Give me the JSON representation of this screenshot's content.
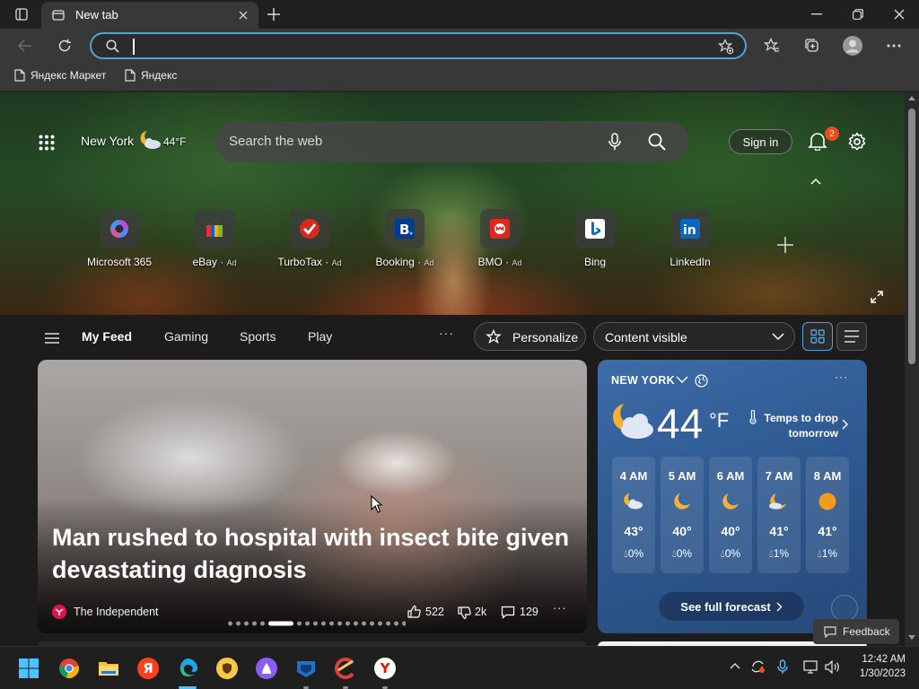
{
  "browser": {
    "tab_title": "New tab",
    "address_value": "",
    "bookmarks": [
      {
        "label": "Яндекс Маркет"
      },
      {
        "label": "Яндекс"
      }
    ]
  },
  "newtab": {
    "location": "New York",
    "temp": "44°F",
    "search_placeholder": "Search the web",
    "sign_in": "Sign in",
    "notifications_count": "2",
    "quick_links": [
      {
        "label": "Microsoft 365",
        "ad": ""
      },
      {
        "label": "eBay",
        "ad": "Ad"
      },
      {
        "label": "TurboTax",
        "ad": "Ad"
      },
      {
        "label": "Booking",
        "ad": "Ad"
      },
      {
        "label": "BMO",
        "ad": "Ad"
      },
      {
        "label": "Bing",
        "ad": ""
      },
      {
        "label": "LinkedIn",
        "ad": ""
      }
    ]
  },
  "feed": {
    "tabs": [
      "My Feed",
      "Gaming",
      "Sports",
      "Play"
    ],
    "more": "···",
    "personalize": "Personalize",
    "content_select": "Content visible",
    "feedback": "Feedback"
  },
  "hero": {
    "headline": "Man rushed to hospital with insect bite given devastating diagnosis",
    "source": "The Independent",
    "likes": "522",
    "dislikes": "2k",
    "comments": "129",
    "active_dot": 5,
    "total_dots": 20
  },
  "weather": {
    "city": "NEW YORK",
    "temp": "44",
    "unit": "°F",
    "alert": "Temps to drop tomorrow",
    "hours": [
      {
        "time": "4 AM",
        "temp": "43°",
        "precip": "0%",
        "icon": "moon-cloud-icon"
      },
      {
        "time": "5 AM",
        "temp": "40°",
        "precip": "0%",
        "icon": "moon-icon"
      },
      {
        "time": "6 AM",
        "temp": "40°",
        "precip": "0%",
        "icon": "moon-icon"
      },
      {
        "time": "7 AM",
        "temp": "41°",
        "precip": "1%",
        "icon": "moon-cloud-icon"
      },
      {
        "time": "8 AM",
        "temp": "41°",
        "precip": "1%",
        "icon": "sun-icon"
      }
    ],
    "forecast_button": "See full forecast"
  },
  "taskbar": {
    "time": "12:42 AM",
    "date": "1/30/2023"
  },
  "colors": {
    "accent": "#4fa3d9",
    "weather_bg": "#2f5a92",
    "badge": "#e74c1c"
  }
}
